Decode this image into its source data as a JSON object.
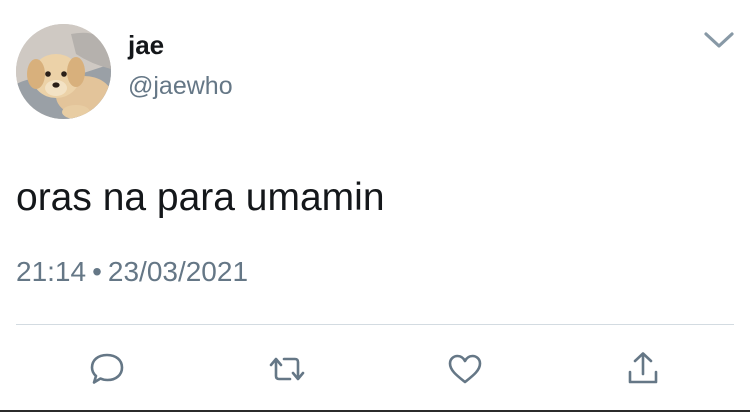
{
  "tweet": {
    "author": {
      "display_name": "jae",
      "handle": "@jaewho",
      "avatar": "golden-retriever-puppy-photo"
    },
    "text": "oras na para umamin",
    "time": "21:14",
    "separator": "•",
    "date": "23/03/2021"
  },
  "icons": {
    "menu": "chevron-down-icon",
    "reply": "speech-bubble-icon",
    "retweet": "retweet-arrows-icon",
    "like": "heart-icon",
    "share": "share-upload-icon"
  },
  "colors": {
    "text": "#14171a",
    "secondary": "#657786",
    "icon": "#657786",
    "divider": "#d3dbe1"
  }
}
